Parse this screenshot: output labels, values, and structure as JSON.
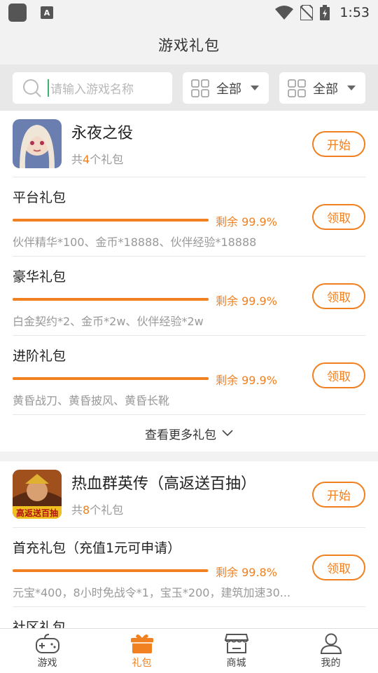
{
  "status_bar": {
    "time": "1:53"
  },
  "header": {
    "title": "游戏礼包"
  },
  "filters": {
    "search_placeholder": "请输入游戏名称",
    "dropdown1_label": "全部",
    "dropdown2_label": "全部"
  },
  "colors": {
    "accent": "#f08020"
  },
  "games": [
    {
      "name": "永夜之役",
      "count_prefix": "共",
      "count": "4",
      "count_suffix": "个礼包",
      "start_label": "开始",
      "packs": [
        {
          "name": "平台礼包",
          "remain": "剩余 99.9%",
          "progress": 0.999,
          "items": "伙伴精华*100、金币*18888、伙伴经验*18888",
          "claim_label": "领取"
        },
        {
          "name": "豪华礼包",
          "remain": "剩余 99.9%",
          "progress": 0.999,
          "items": "白金契约*2、金币*2w、伙伴经验*2w",
          "claim_label": "领取"
        },
        {
          "name": "进阶礼包",
          "remain": "剩余 99.9%",
          "progress": 0.999,
          "items": "黄昏战刀、黄昏披风、黄昏长靴",
          "claim_label": "领取"
        }
      ],
      "more_label": "查看更多礼包"
    },
    {
      "name": "热血群英传（高返送百抽）",
      "icon_text": "高返送百抽",
      "count_prefix": "共",
      "count": "8",
      "count_suffix": "个礼包",
      "start_label": "开始",
      "packs": [
        {
          "name": "首充礼包（充值1元可申请）",
          "remain": "剩余 99.8%",
          "progress": 0.998,
          "items": "元宝*400，8小时免战令*1，宝玉*200，建筑加速30...",
          "claim_label": "领取"
        },
        {
          "name": "社区礼包"
        }
      ]
    }
  ],
  "tabbar": {
    "tabs": [
      {
        "label": "游戏",
        "icon": "gamepad-icon"
      },
      {
        "label": "礼包",
        "icon": "gift-icon"
      },
      {
        "label": "商城",
        "icon": "store-icon"
      },
      {
        "label": "我的",
        "icon": "user-icon"
      }
    ]
  }
}
